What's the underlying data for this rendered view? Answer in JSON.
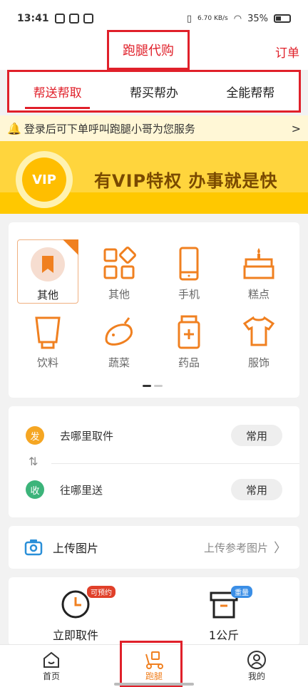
{
  "status_bar": {
    "time": "13:41",
    "net_speed": "6.70 KB/s",
    "battery": "35%"
  },
  "header": {
    "title": "跑腿代购",
    "order_link": "订单"
  },
  "tabs": [
    {
      "label": "帮送帮取",
      "active": true
    },
    {
      "label": "帮买帮办",
      "active": false
    },
    {
      "label": "全能帮帮",
      "active": false
    }
  ],
  "notice": {
    "text": "登录后可下单呼叫跑腿小哥为您服务",
    "arrow": ">"
  },
  "vip_banner": {
    "badge": "VIP",
    "text": "有VIP特权 办事就是快"
  },
  "categories": [
    {
      "label": "其他",
      "icon": "bookmark-icon",
      "selected": true
    },
    {
      "label": "其他",
      "icon": "grid-icon",
      "selected": false
    },
    {
      "label": "手机",
      "icon": "phone-icon",
      "selected": false
    },
    {
      "label": "糕点",
      "icon": "cake-icon",
      "selected": false
    },
    {
      "label": "饮料",
      "icon": "drink-icon",
      "selected": false
    },
    {
      "label": "蔬菜",
      "icon": "eggplant-icon",
      "selected": false
    },
    {
      "label": "药品",
      "icon": "medicine-icon",
      "selected": false
    },
    {
      "label": "服饰",
      "icon": "shirt-icon",
      "selected": false
    }
  ],
  "address": {
    "pickup": {
      "badge": "发",
      "text": "去哪里取件",
      "button": "常用"
    },
    "delivery": {
      "badge": "收",
      "text": "往哪里送",
      "button": "常用"
    }
  },
  "upload": {
    "label": "上传图片",
    "hint": "上传参考图片"
  },
  "options": [
    {
      "label": "立即取件",
      "tag": "可预约"
    },
    {
      "label": "1公斤",
      "tag": "重量"
    }
  ],
  "bottom_nav": [
    {
      "label": "首页",
      "active": false
    },
    {
      "label": "跑腿",
      "active": true
    },
    {
      "label": "我的",
      "active": false
    }
  ],
  "colors": {
    "accent_red": "#e0202a",
    "accent_orange": "#f08020",
    "vip_yellow": "#ffd53d"
  }
}
